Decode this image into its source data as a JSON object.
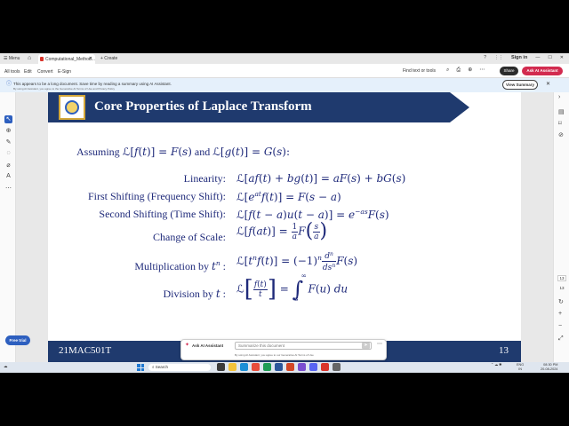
{
  "browser": {
    "menu_label": "Menu",
    "tab_title": "Computational_Method...",
    "create_label": "+ Create",
    "sign_in": "Sign in"
  },
  "toolbar": {
    "all_tools": "All tools",
    "edit": "Edit",
    "convert": "Convert",
    "esign": "E-Sign",
    "find": "Find text or tools",
    "share": "Share",
    "ask_ai": "Ask AI Assistant"
  },
  "notice": {
    "message": "This appears to be a long document. Save time by reading a summary using AI Assistant.",
    "disclaimer": "By using AI Assistant, you agree to the Generative AI Terms of Use and Privacy Policy",
    "button": "View Summary"
  },
  "slide": {
    "title": "Core Properties of Laplace Transform",
    "intro_prefix": "Assuming",
    "intro_and": "and",
    "labels": {
      "linearity": "Linearity:",
      "first_shift": "First Shifting (Frequency Shift):",
      "second_shift": "Second Shifting (Time Shift):",
      "scale": "Change of Scale:",
      "mult_prefix": "Multiplication by",
      "div_prefix": "Division by"
    },
    "course_code": "21MAC501T",
    "page_number": "13"
  },
  "side": {
    "free_trial": "Free trial",
    "page_current": "13",
    "page_total": "13"
  },
  "ai_popup": {
    "title": "Ask AI Assistant",
    "placeholder": "Summarize this document",
    "disclaimer": "By using AI Assistant, you agree to our Generative AI Terms of Use"
  },
  "taskbar": {
    "search_placeholder": "Search",
    "language": "ENG",
    "region": "IN",
    "time": "08:30 PM",
    "date": "20-08-2024"
  },
  "colors": {
    "slide_navy": "#1f3a6e",
    "math_ink": "#1f2a7a",
    "accent_red": "#d22b4f",
    "accent_blue": "#2d5fbf"
  }
}
